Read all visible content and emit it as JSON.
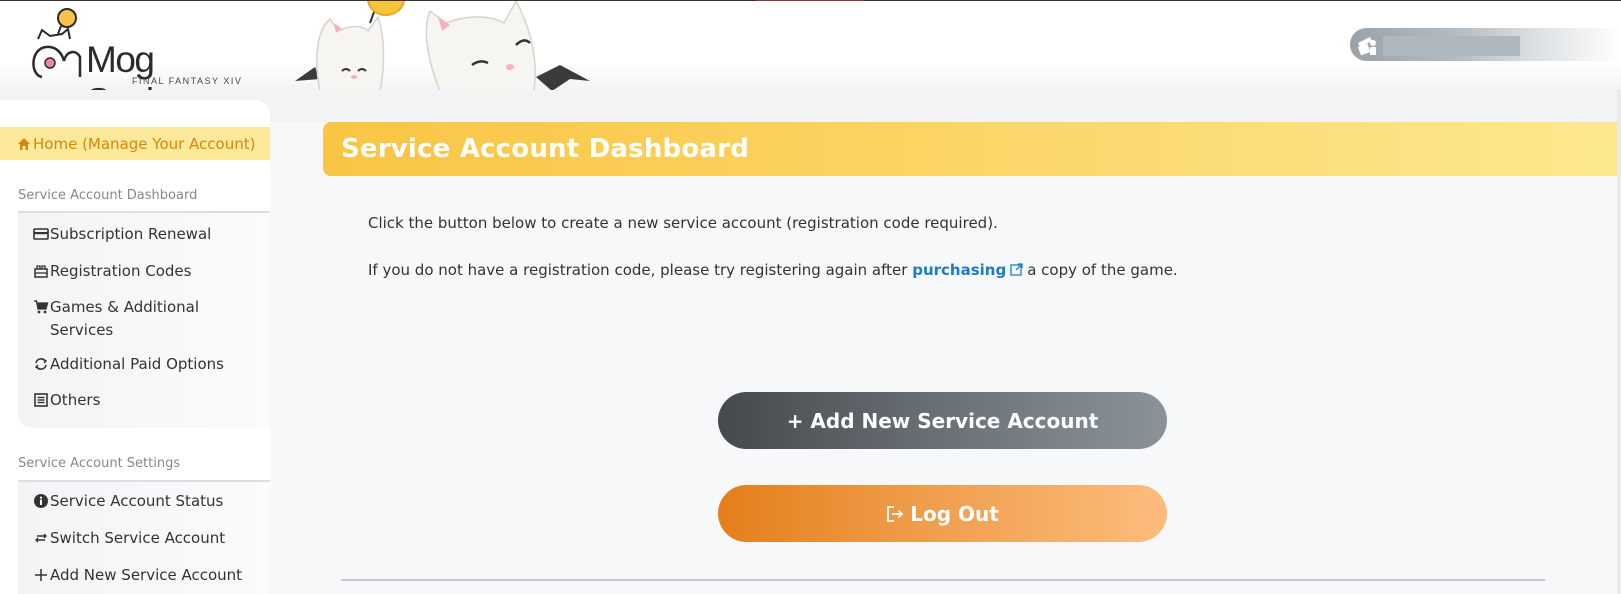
{
  "header": {
    "logo_text": "Mog Station",
    "logo_subtext": "FINAL FANTASY XIV",
    "user_name": ""
  },
  "sidebar": {
    "home": {
      "label": "Home (Manage Your Account)",
      "icon": "home-icon"
    },
    "sections": [
      {
        "title": "Service Account Dashboard",
        "items": [
          {
            "label": "Subscription Renewal",
            "icon": "credit-card-icon"
          },
          {
            "label": "Registration Codes",
            "icon": "gift-code-icon"
          },
          {
            "label": "Games & Additional Services",
            "icon": "cart-icon"
          },
          {
            "label": "Additional Paid Options",
            "icon": "refresh-icon"
          },
          {
            "label": "Others",
            "icon": "list-icon"
          }
        ]
      },
      {
        "title": "Service Account Settings",
        "items": [
          {
            "label": "Service Account Status",
            "icon": "info-icon"
          },
          {
            "label": "Switch Service Account",
            "icon": "switch-arrows-icon"
          },
          {
            "label": "Add New Service Account",
            "icon": "plus-icon"
          }
        ]
      }
    ]
  },
  "main": {
    "title": "Service Account Dashboard",
    "paragraph1": "Click the button below to create a new service account (registration code required).",
    "paragraph2_before": "If you do not have a registration code, please try registering again after",
    "paragraph2_link": "purchasing",
    "paragraph2_after": "a copy of the game.",
    "add_button": "+ Add New Service Account",
    "logout_button": "Log Out"
  },
  "colors": {
    "accent_yellow": "#f9c543",
    "home_text": "#d8860f",
    "link_blue": "#1f7bc3",
    "logout_orange": "#e57e1b",
    "add_gray": "#45494d"
  }
}
